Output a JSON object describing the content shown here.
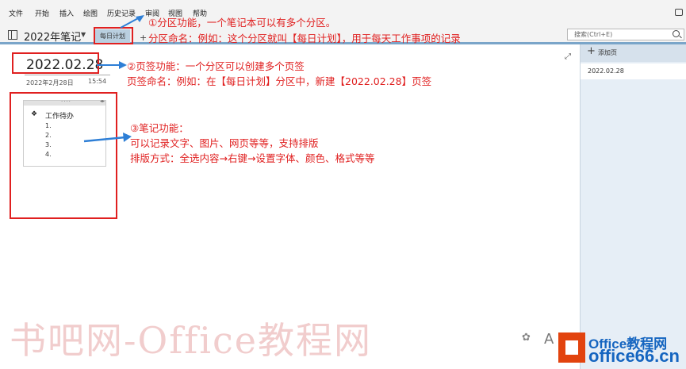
{
  "menu": {
    "file": "文件",
    "home": "开始",
    "insert": "插入",
    "draw": "绘图",
    "history": "历史记录",
    "review": "审阅",
    "view": "视图",
    "help": "帮助"
  },
  "notebook": {
    "title": "2022年笔记",
    "section_tab": "每日计划",
    "add_section": "+"
  },
  "search": {
    "placeholder": "搜索(Ctrl+E)"
  },
  "page": {
    "title": "2022.02.28",
    "date": "2022年2月28日",
    "time": "15:54"
  },
  "note": {
    "bullet": "❖",
    "heading": "工作待办",
    "items": [
      "1.",
      "2.",
      "3.",
      "4."
    ]
  },
  "pages_pane": {
    "add_page": "添加页",
    "items": [
      "2022.02.28"
    ]
  },
  "annotations": {
    "a1": "①分区功能，一个笔记本可以有多个分区。",
    "a2": "分区命名：例如：这个分区就叫【每日计划】，用于每天工作事项的记录",
    "a3": "②页签功能：一个分区可以创建多个页签",
    "a4": "页签命名：例如：在【每日计划】分区中，新建【2022.02.28】页签",
    "a5": "③笔记功能：",
    "a6": "可以记录文字、图片、网页等等，支持排版",
    "a7": "排版方式：全选内容→右键→设置字体、颜色、格式等等",
    "arrow_color": "#2e7fd6",
    "box_color": "#e02020"
  },
  "watermark": {
    "main": "书吧网-Office教程网",
    "handle": "A",
    "site1": "Office教程网",
    "site2": "office66.cn"
  }
}
